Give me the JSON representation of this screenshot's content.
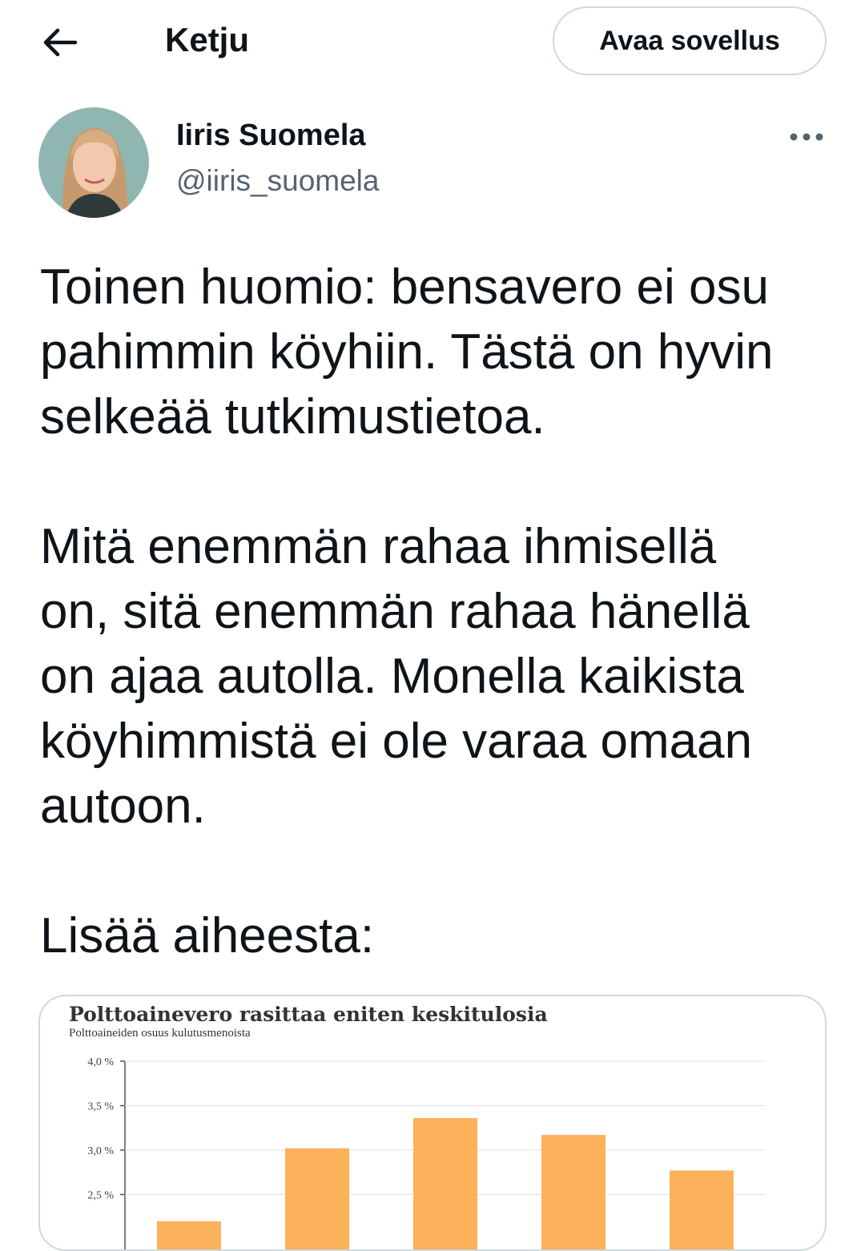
{
  "header": {
    "title": "Ketju",
    "open_app_label": "Avaa sovellus"
  },
  "author": {
    "name": "Iiris Suomela",
    "handle": "@iiris_suomela"
  },
  "tweet": {
    "lines": [
      "Toinen huomio: bensavero ei osu",
      "pahimmin köyhiin. Tästä on hyvin",
      "selkeää tutkimustietoa.",
      "",
      "Mitä enemmän rahaa ihmisellä",
      "on, sitä enemmän rahaa hänellä",
      "on ajaa autolla. Monella kaikista",
      "köyhimmistä ei ole varaa omaan",
      "autoon.",
      "",
      "Lisää aiheesta:"
    ]
  },
  "chart_data": {
    "type": "bar",
    "title": "Polttoainevero rasittaa eniten keskitulosia",
    "subtitle": "Polttoaineiden osuus kulutusmenoista",
    "yticks": [
      "4,0 %",
      "3,5 %",
      "3,0 %",
      "2,5 %"
    ],
    "ylim": [
      2.0,
      4.0
    ],
    "values": [
      2.2,
      3.02,
      3.36,
      3.17,
      2.77
    ],
    "bar_color": "#fbb25a",
    "grid": true
  },
  "colors": {
    "text": "#0f1419",
    "secondary": "#536471",
    "border": "#cfd9de"
  }
}
